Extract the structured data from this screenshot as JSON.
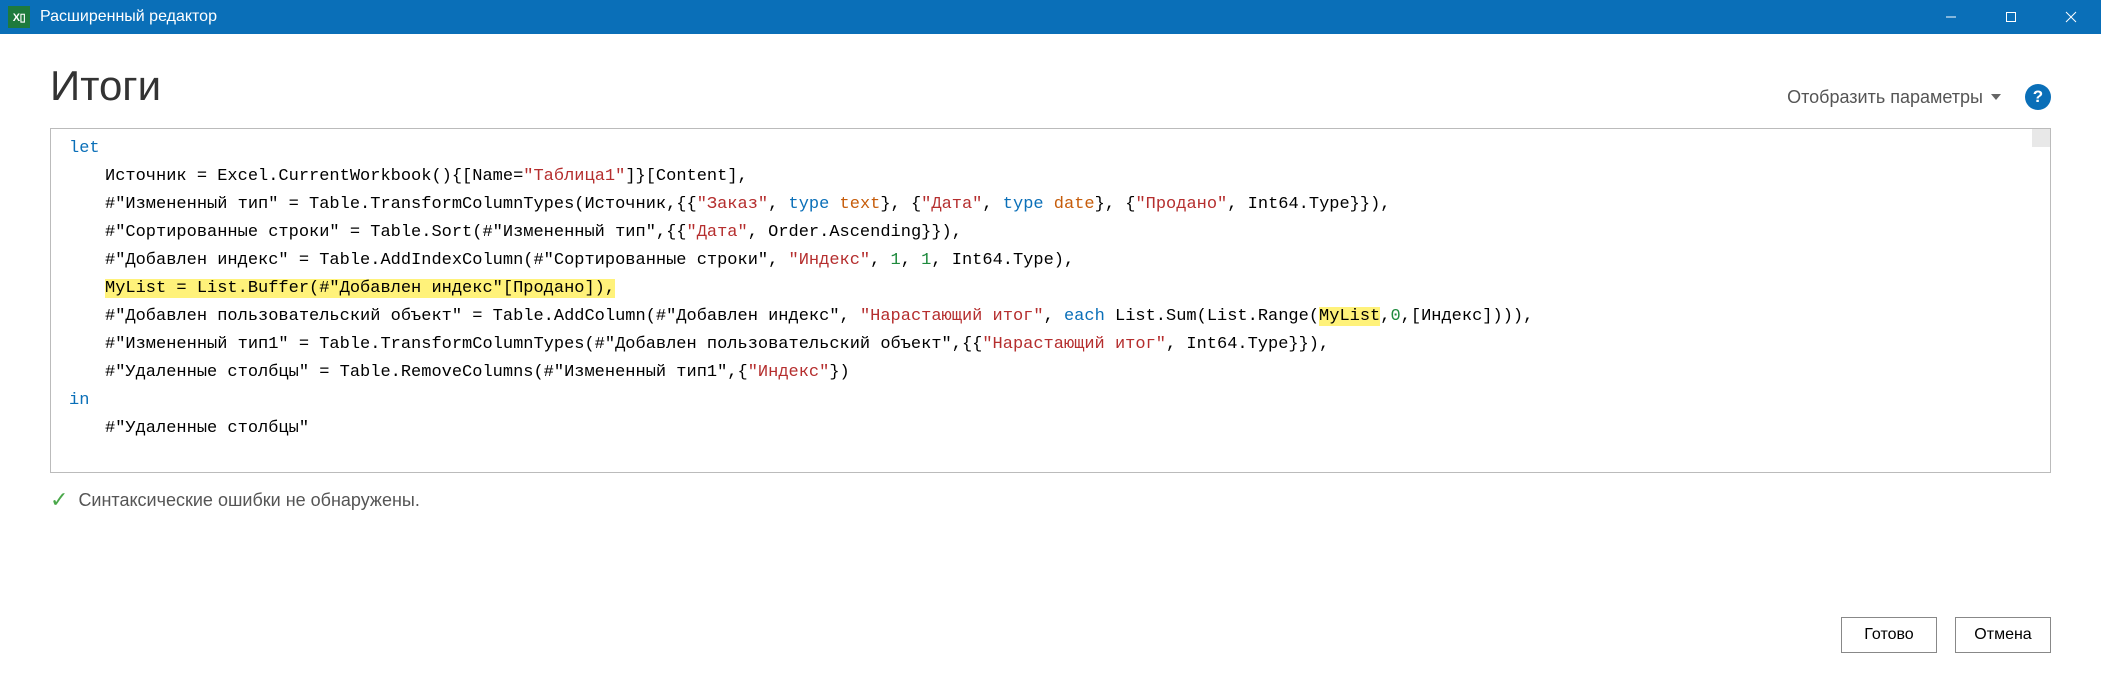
{
  "window": {
    "title": "Расширенный редактор",
    "appicon_text": "X▯"
  },
  "header": {
    "page_title": "Итоги",
    "params_label": "Отобразить параметры",
    "help_label": "?"
  },
  "code": {
    "let": "let",
    "in": "in",
    "line1_a": "Источник = Excel.CurrentWorkbook(){[Name=",
    "line1_b": "\"Таблица1\"",
    "line1_c": "]}[Content],",
    "line2_a": "#\"Измененный тип\" = Table.TransformColumnTypes(Источник,{{",
    "line2_b": "\"Заказ\"",
    "line2_c": ", ",
    "line2_d1": "type",
    "line2_d2": " text",
    "line2_e": "}, {",
    "line2_f": "\"Дата\"",
    "line2_g": ", ",
    "line2_h1": "type",
    "line2_h2": " date",
    "line2_i": "}, {",
    "line2_j": "\"Продано\"",
    "line2_k": ", Int64.Type}}),",
    "line3_a": "#\"Сортированные строки\" = Table.Sort(#\"Измененный тип\",{{",
    "line3_b": "\"Дата\"",
    "line3_c": ", Order.Ascending}}),",
    "line4_a": "#\"Добавлен индекс\" = Table.AddIndexColumn(#\"Сортированные строки\", ",
    "line4_b": "\"Индекс\"",
    "line4_c": ", ",
    "line4_d": "1",
    "line4_e": ", ",
    "line4_f": "1",
    "line4_g": ", Int64.Type),",
    "line5_hl": "MyList = List.Buffer(#\"Добавлен индекс\"[Продано]),",
    "line6_a": "#\"Добавлен пользовательский объект\" = Table.AddColumn(#\"Добавлен индекс\", ",
    "line6_b": "\"Нарастающий итог\"",
    "line6_c": ", ",
    "line6_d": "each",
    "line6_e": " List.Sum(List.Range(",
    "line6_f": "MyList",
    "line6_g": ",",
    "line6_h": "0",
    "line6_i": ",[Индекс]))),",
    "line7_a": "#\"Измененный тип1\" = Table.TransformColumnTypes(#\"Добавлен пользовательский объект\",{{",
    "line7_b": "\"Нарастающий итог\"",
    "line7_c": ", Int64.Type}}),",
    "line8_a": "#\"Удаленные столбцы\" = Table.RemoveColumns(#\"Измененный тип1\",{",
    "line8_b": "\"Индекс\"",
    "line8_c": "})",
    "line9": "#\"Удаленные столбцы\""
  },
  "status": {
    "text": "Синтаксические ошибки не обнаружены."
  },
  "footer": {
    "done": "Готово",
    "cancel": "Отмена"
  }
}
